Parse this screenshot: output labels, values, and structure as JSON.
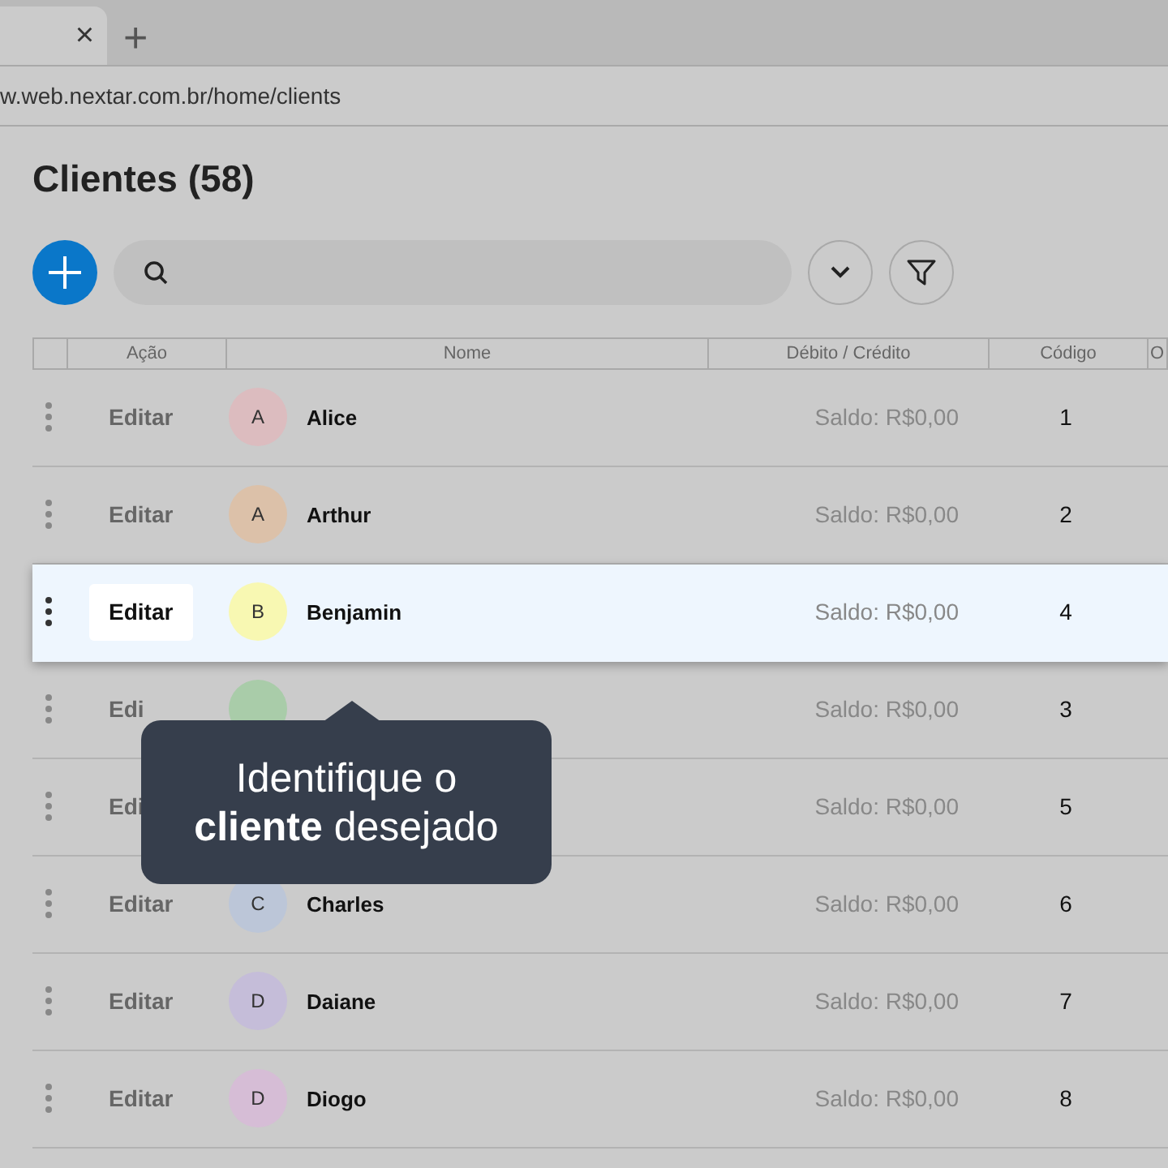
{
  "browser": {
    "tab_close": "×",
    "new_tab": "+",
    "address": "w.web.nextar.com.br/home/clients"
  },
  "page": {
    "title": "Clientes (58)"
  },
  "table": {
    "columns": [
      "Ação",
      "Nome",
      "Débito / Crédito",
      "Código",
      "O"
    ],
    "rows": [
      {
        "action": "Editar",
        "avatar": "A",
        "color": "#dcbcbf",
        "name": "Alice",
        "balance": "Saldo: R$0,00",
        "code": "1",
        "selected": false
      },
      {
        "action": "Editar",
        "avatar": "A",
        "color": "#dcc1a9",
        "name": "Arthur",
        "balance": "Saldo: R$0,00",
        "code": "2",
        "selected": false
      },
      {
        "action": "Editar",
        "avatar": "B",
        "color": "#f8f8b2",
        "name": "Benjamin",
        "balance": "Saldo: R$0,00",
        "code": "4",
        "selected": true
      },
      {
        "action": "Edi",
        "color": "#a9cca9",
        "balance": "Saldo: R$0,00",
        "code": "3",
        "selected": false
      },
      {
        "action": "Edi",
        "balance": "Saldo: R$0,00",
        "code": "5",
        "selected": false
      },
      {
        "action": "Editar",
        "avatar": "C",
        "color": "#bcc6d8",
        "name": "Charles",
        "balance": "Saldo: R$0,00",
        "code": "6",
        "selected": false
      },
      {
        "action": "Editar",
        "avatar": "D",
        "color": "#c5bdd9",
        "name": "Daiane",
        "balance": "Saldo: R$0,00",
        "code": "7",
        "selected": false
      },
      {
        "action": "Editar",
        "avatar": "D",
        "color": "#d6bdd6",
        "name": "Diogo",
        "balance": "Saldo: R$0,00",
        "code": "8",
        "selected": false
      }
    ]
  },
  "tooltip": {
    "text": "Identifique o **cliente** desejado"
  }
}
